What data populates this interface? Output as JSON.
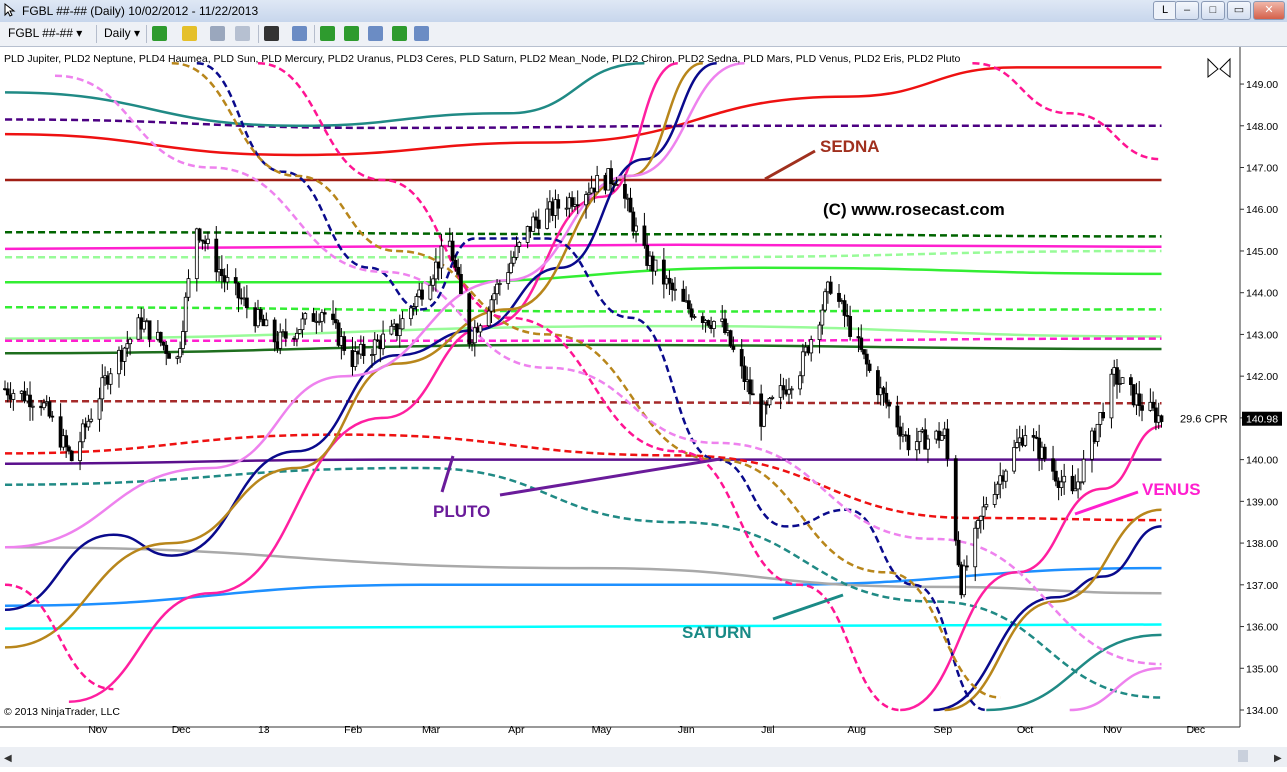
{
  "window": {
    "title": "FGBL ##-## (Daily)  10/02/2012 - 11/22/2013",
    "buttons": {
      "l": "L",
      "minimize": "–",
      "restore": "□",
      "maximize": "▭",
      "close": "✕"
    }
  },
  "toolbar": {
    "instrument": "FGBL ##-##",
    "interval": "Daily",
    "icons": [
      "bar-chart-icon",
      "candlestick-icon",
      "pencil-icon",
      "drawing-tools-icon",
      "crosshair-icon",
      "zoom-icon",
      "strategy-icon",
      "indicators-icon",
      "data-box-icon",
      "order-icon",
      "properties-icon"
    ]
  },
  "chart_data": {
    "type": "candlestick",
    "indicator_list": "PLD Jupiter, PLD2 Neptune, PLD4 Haumea, PLD Sun, PLD Mercury, PLD2 Uranus, PLD3 Ceres, PLD Saturn, PLD2 Mean_Node, PLD2 Chiron, PLD2 Sedna, PLD Mars, PLD Venus, PLD2 Eris, PLD2 Pluto",
    "copyright": "© 2013 NinjaTrader, LLC",
    "watermark": "(C) www.rosecast.com",
    "x_ticks": [
      "Nov",
      "Dec",
      "13",
      "Feb",
      "Mar",
      "Apr",
      "May",
      "Jun",
      "Jul",
      "Aug",
      "Sep",
      "Oct",
      "Nov",
      "Dec"
    ],
    "y_ticks": [
      "134.00",
      "135.00",
      "136.00",
      "137.00",
      "138.00",
      "139.00",
      "140.00",
      "141.00",
      "142.00",
      "143.00",
      "144.00",
      "145.00",
      "146.00",
      "147.00",
      "148.00",
      "149.00"
    ],
    "ylim": [
      134,
      149.5
    ],
    "last_price": "140.98",
    "cpr_label": "29.6 CPR",
    "annotations": [
      {
        "text": "SEDNA",
        "color": "#a0301e"
      },
      {
        "text": "PLUTO",
        "color": "#6a1b9a"
      },
      {
        "text": "VENUS",
        "color": "#ff1fcf"
      },
      {
        "text": "SATURN",
        "color": "#1a8a86"
      }
    ],
    "price_series": {
      "name": "FGBL ##-##",
      "anchors": [
        [
          "10/02/2012",
          141.7
        ],
        [
          "10/15/2012",
          141.4
        ],
        [
          "10/26/2012",
          140.0
        ],
        [
          "11/09/2012",
          142.2
        ],
        [
          "11/20/2012",
          143.3
        ],
        [
          "12/03/2012",
          142.4
        ],
        [
          "12/10/2012",
          145.6
        ],
        [
          "12/20/2012",
          144.3
        ],
        [
          "01/08/2013",
          142.8
        ],
        [
          "01/24/2013",
          143.6
        ],
        [
          "02/04/2013",
          142.4
        ],
        [
          "02/20/2013",
          143.1
        ],
        [
          "03/11/2013",
          145.2
        ],
        [
          "03/18/2013",
          142.9
        ],
        [
          "04/10/2013",
          145.7
        ],
        [
          "05/02/2013",
          146.6
        ],
        [
          "05/10/2013",
          146.8
        ],
        [
          "05/20/2013",
          144.9
        ],
        [
          "06/03/2013",
          143.7
        ],
        [
          "06/17/2013",
          143.2
        ],
        [
          "07/01/2013",
          141.0
        ],
        [
          "07/15/2013",
          142.2
        ],
        [
          "07/26/2013",
          144.2
        ],
        [
          "08/09/2013",
          142.1
        ],
        [
          "08/23/2013",
          140.4
        ],
        [
          "09/05/2013",
          140.6
        ],
        [
          "09/11/2013",
          137.0
        ],
        [
          "09/20/2013",
          139.0
        ],
        [
          "10/04/2013",
          140.7
        ],
        [
          "10/21/2013",
          139.1
        ],
        [
          "11/05/2013",
          142.0
        ],
        [
          "11/15/2013",
          141.3
        ],
        [
          "11/22/2013",
          140.98
        ]
      ]
    },
    "series": [
      {
        "name": "PLD2 Sedna",
        "color": "#a01e14",
        "style": "solid",
        "points": [
          [
            "10/02/2012",
            146.7
          ],
          [
            "11/22/2013",
            146.7
          ]
        ]
      },
      {
        "name": "PLD2 Pluto",
        "color": "#5a0f8c",
        "style": "solid",
        "points": [
          [
            "10/02/2012",
            139.9
          ],
          [
            "02/15/2013",
            140.0
          ],
          [
            "07/15/2013",
            140.0
          ],
          [
            "11/22/2013",
            140.0
          ]
        ]
      },
      {
        "name": "PLD Saturn",
        "color": "#00ffff",
        "style": "solid",
        "points": [
          [
            "10/02/2012",
            135.95
          ],
          [
            "11/22/2013",
            136.05
          ]
        ]
      },
      {
        "name": "Dodger blue",
        "color": "#1e90ff",
        "style": "solid",
        "points": [
          [
            "10/02/2012",
            136.5
          ],
          [
            "03/01/2013",
            137.0
          ],
          [
            "07/01/2013",
            137.0
          ],
          [
            "11/22/2013",
            137.4
          ]
        ]
      },
      {
        "name": "Gray",
        "color": "#a9a9a9",
        "style": "solid",
        "points": [
          [
            "10/02/2012",
            137.9
          ],
          [
            "05/01/2013",
            137.4
          ],
          [
            "09/01/2013",
            136.95
          ],
          [
            "11/22/2013",
            136.8
          ]
        ]
      },
      {
        "name": "Red",
        "color": "#ee1111",
        "style": "solid",
        "points": [
          [
            "10/02/2012",
            147.8
          ],
          [
            "01/15/2013",
            147.3
          ],
          [
            "04/15/2013",
            147.6
          ],
          [
            "08/01/2013",
            148.7
          ],
          [
            "10/01/2013",
            149.4
          ],
          [
            "11/22/2013",
            149.4
          ]
        ]
      },
      {
        "name": "Purple dash",
        "color": "#4b0082",
        "style": "dash",
        "points": [
          [
            "10/02/2012",
            148.15
          ],
          [
            "02/15/2013",
            147.95
          ],
          [
            "07/01/2013",
            148.0
          ],
          [
            "11/22/2013",
            148.0
          ]
        ]
      },
      {
        "name": "Dark green dash",
        "color": "#006400",
        "style": "dash",
        "points": [
          [
            "10/02/2012",
            145.45
          ],
          [
            "06/15/2013",
            145.4
          ],
          [
            "11/22/2013",
            145.35
          ]
        ]
      },
      {
        "name": "Magenta",
        "color": "#ff1fcf",
        "style": "solid",
        "points": [
          [
            "10/02/2012",
            145.05
          ],
          [
            "06/01/2013",
            145.15
          ],
          [
            "11/22/2013",
            145.1
          ]
        ]
      },
      {
        "name": "Lime",
        "color": "#33ee33",
        "style": "solid",
        "points": [
          [
            "10/02/2012",
            144.25
          ],
          [
            "03/01/2013",
            144.25
          ],
          [
            "07/01/2013",
            144.6
          ],
          [
            "11/22/2013",
            144.45
          ]
        ]
      },
      {
        "name": "Lime dash",
        "color": "#33ee33",
        "style": "dash",
        "points": [
          [
            "10/02/2012",
            143.65
          ],
          [
            "06/01/2013",
            143.55
          ],
          [
            "11/22/2013",
            143.6
          ]
        ]
      },
      {
        "name": "Light green",
        "color": "#98fb98",
        "style": "solid",
        "points": [
          [
            "10/02/2012",
            142.9
          ],
          [
            "06/01/2013",
            143.2
          ],
          [
            "11/22/2013",
            142.95
          ]
        ]
      },
      {
        "name": "Magenta dash",
        "color": "#ff1fcf",
        "style": "dash",
        "points": [
          [
            "10/02/2012",
            142.85
          ],
          [
            "06/01/2013",
            142.85
          ],
          [
            "11/22/2013",
            142.9
          ]
        ]
      },
      {
        "name": "Dark green",
        "color": "#1e6e1e",
        "style": "solid",
        "points": [
          [
            "10/02/2012",
            142.55
          ],
          [
            "05/01/2013",
            142.75
          ],
          [
            "11/22/2013",
            142.65
          ]
        ]
      },
      {
        "name": "Brown dash",
        "color": "#a52a2a",
        "style": "dash",
        "points": [
          [
            "10/02/2012",
            141.4
          ],
          [
            "11/22/2013",
            141.35
          ]
        ]
      },
      {
        "name": "Red dash",
        "color": "#ee1111",
        "style": "dash",
        "points": [
          [
            "10/02/2012",
            140.15
          ],
          [
            "02/01/2013",
            140.6
          ],
          [
            "06/01/2013",
            140.1
          ],
          [
            "09/15/2013",
            138.6
          ],
          [
            "11/22/2013",
            138.55
          ]
        ]
      },
      {
        "name": "Teal dash",
        "color": "#208a85",
        "style": "dash",
        "points": [
          [
            "10/02/2012",
            139.4
          ],
          [
            "03/01/2013",
            139.8
          ],
          [
            "06/01/2013",
            138.5
          ],
          [
            "09/01/2013",
            136.6
          ],
          [
            "11/22/2013",
            134.3
          ]
        ]
      },
      {
        "name": "Pale green dash",
        "color": "#98fb98",
        "style": "dash",
        "points": [
          [
            "10/02/2012",
            144.85
          ],
          [
            "06/01/2013",
            144.85
          ],
          [
            "11/22/2013",
            145.0
          ]
        ]
      },
      {
        "name": "Teal",
        "color": "#208a85",
        "style": "solid",
        "points": [
          [
            "10/02/2012",
            148.8
          ],
          [
            "01/15/2013",
            148.0
          ],
          [
            "04/01/2013",
            148.3
          ],
          [
            "05/20/2013",
            149.5
          ]
        ]
      },
      {
        "name": "Teal rising",
        "color": "#208a85",
        "style": "solid",
        "points": [
          [
            "09/20/2013",
            134.0
          ],
          [
            "11/22/2013",
            135.8
          ]
        ]
      },
      {
        "name": "PLD Venus",
        "color": "#ff1fa0",
        "style": "solid",
        "points": [
          [
            "10/25/2012",
            134.2
          ],
          [
            "12/15/2012",
            136.8
          ],
          [
            "02/15/2013",
            141.0
          ],
          [
            "03/25/2013",
            143.2
          ],
          [
            "05/05/2013",
            146.3
          ],
          [
            "06/01/2013",
            149.5
          ]
        ]
      },
      {
        "name": "PLD Venus 2",
        "color": "#ff1fa0",
        "style": "solid",
        "points": [
          [
            "08/20/2013",
            134.0
          ],
          [
            "10/01/2013",
            137.3
          ],
          [
            "11/01/2013",
            139.3
          ],
          [
            "11/22/2013",
            140.8
          ]
        ]
      },
      {
        "name": "Navy",
        "color": "#0a0a8c",
        "style": "solid",
        "points": [
          [
            "10/02/2012",
            136.4
          ],
          [
            "11/10/2012",
            138.2
          ],
          [
            "12/01/2012",
            137.7
          ],
          [
            "01/15/2013",
            140.2
          ],
          [
            "02/20/2013",
            142.5
          ],
          [
            "03/20/2013",
            143.1
          ],
          [
            "04/20/2013",
            144.6
          ],
          [
            "05/20/2013",
            147.2
          ],
          [
            "06/15/2013",
            149.5
          ]
        ]
      },
      {
        "name": "Navy 2",
        "color": "#0a0a8c",
        "style": "solid",
        "points": [
          [
            "09/01/2013",
            134.0
          ],
          [
            "10/15/2013",
            136.7
          ],
          [
            "11/01/2013",
            137.2
          ],
          [
            "11/22/2013",
            138.4
          ]
        ]
      },
      {
        "name": "Goldenrod",
        "color": "#b8861b",
        "style": "solid",
        "points": [
          [
            "10/02/2012",
            135.5
          ],
          [
            "12/01/2012",
            138.0
          ],
          [
            "01/15/2013",
            139.8
          ],
          [
            "02/20/2013",
            142.3
          ],
          [
            "04/01/2013",
            143.6
          ],
          [
            "05/15/2013",
            146.8
          ],
          [
            "06/10/2013",
            149.5
          ]
        ]
      },
      {
        "name": "Goldenrod 2",
        "color": "#b8861b",
        "style": "solid",
        "points": [
          [
            "09/05/2013",
            134.0
          ],
          [
            "10/15/2013",
            136.6
          ],
          [
            "11/22/2013",
            138.8
          ]
        ]
      },
      {
        "name": "Violet",
        "color": "#ee82ee",
        "style": "solid",
        "points": [
          [
            "10/02/2012",
            137.9
          ],
          [
            "12/15/2012",
            139.8
          ],
          [
            "02/01/2013",
            142.0
          ],
          [
            "04/01/2013",
            144.3
          ],
          [
            "05/15/2013",
            146.8
          ],
          [
            "06/25/2013",
            149.5
          ]
        ]
      },
      {
        "name": "Violet 2",
        "color": "#ee82ee",
        "style": "solid",
        "points": [
          [
            "10/20/2013",
            134.0
          ],
          [
            "11/22/2013",
            135.0
          ]
        ]
      },
      {
        "name": "Navy dash",
        "color": "#0a0a8c",
        "style": "dash",
        "points": [
          [
            "12/10/2012",
            149.5
          ],
          [
            "01/10/2013",
            146.9
          ],
          [
            "02/10/2013",
            144.6
          ],
          [
            "03/01/2013",
            143.6
          ],
          [
            "03/20/2013",
            145.3
          ],
          [
            "04/15/2013",
            145.3
          ],
          [
            "05/15/2013",
            143.4
          ],
          [
            "06/15/2013",
            140.0
          ],
          [
            "07/10/2013",
            138.4
          ],
          [
            "08/01/2013",
            138.8
          ],
          [
            "08/25/2013",
            137.0
          ],
          [
            "09/20/2013",
            134.0
          ]
        ]
      },
      {
        "name": "Goldenrod dash",
        "color": "#b8861b",
        "style": "dash",
        "points": [
          [
            "12/01/2012",
            149.5
          ],
          [
            "01/15/2013",
            146.8
          ],
          [
            "02/20/2013",
            145.0
          ],
          [
            "04/15/2013",
            143.0
          ],
          [
            "06/15/2013",
            140.0
          ],
          [
            "08/15/2013",
            137.3
          ],
          [
            "09/25/2013",
            134.3
          ]
        ]
      },
      {
        "name": "Deep pink dash",
        "color": "#ff1493",
        "style": "dash",
        "points": [
          [
            "01/01/2013",
            149.5
          ],
          [
            "02/15/2013",
            146.7
          ],
          [
            "04/01/2013",
            143.4
          ],
          [
            "06/01/2013",
            140.2
          ],
          [
            "07/15/2013",
            137.0
          ],
          [
            "08/20/2013",
            134.0
          ]
        ]
      },
      {
        "name": "Deep pink dash 2",
        "color": "#ff1493",
        "style": "dash",
        "points": [
          [
            "10/02/2012",
            137.0
          ],
          [
            "11/10/2012",
            134.5
          ]
        ]
      },
      {
        "name": "Deep pink dash 3",
        "color": "#ff1493",
        "style": "dash",
        "points": [
          [
            "09/15/2013",
            149.5
          ],
          [
            "10/20/2013",
            148.3
          ],
          [
            "11/22/2013",
            147.2
          ]
        ]
      },
      {
        "name": "Violet dash",
        "color": "#ee82ee",
        "style": "dash",
        "points": [
          [
            "10/20/2012",
            149.2
          ],
          [
            "12/15/2012",
            147.0
          ],
          [
            "02/15/2013",
            144.5
          ],
          [
            "04/15/2013",
            142.2
          ],
          [
            "06/15/2013",
            140.4
          ],
          [
            "09/01/2013",
            138.1
          ],
          [
            "11/22/2013",
            135.1
          ]
        ]
      }
    ]
  }
}
